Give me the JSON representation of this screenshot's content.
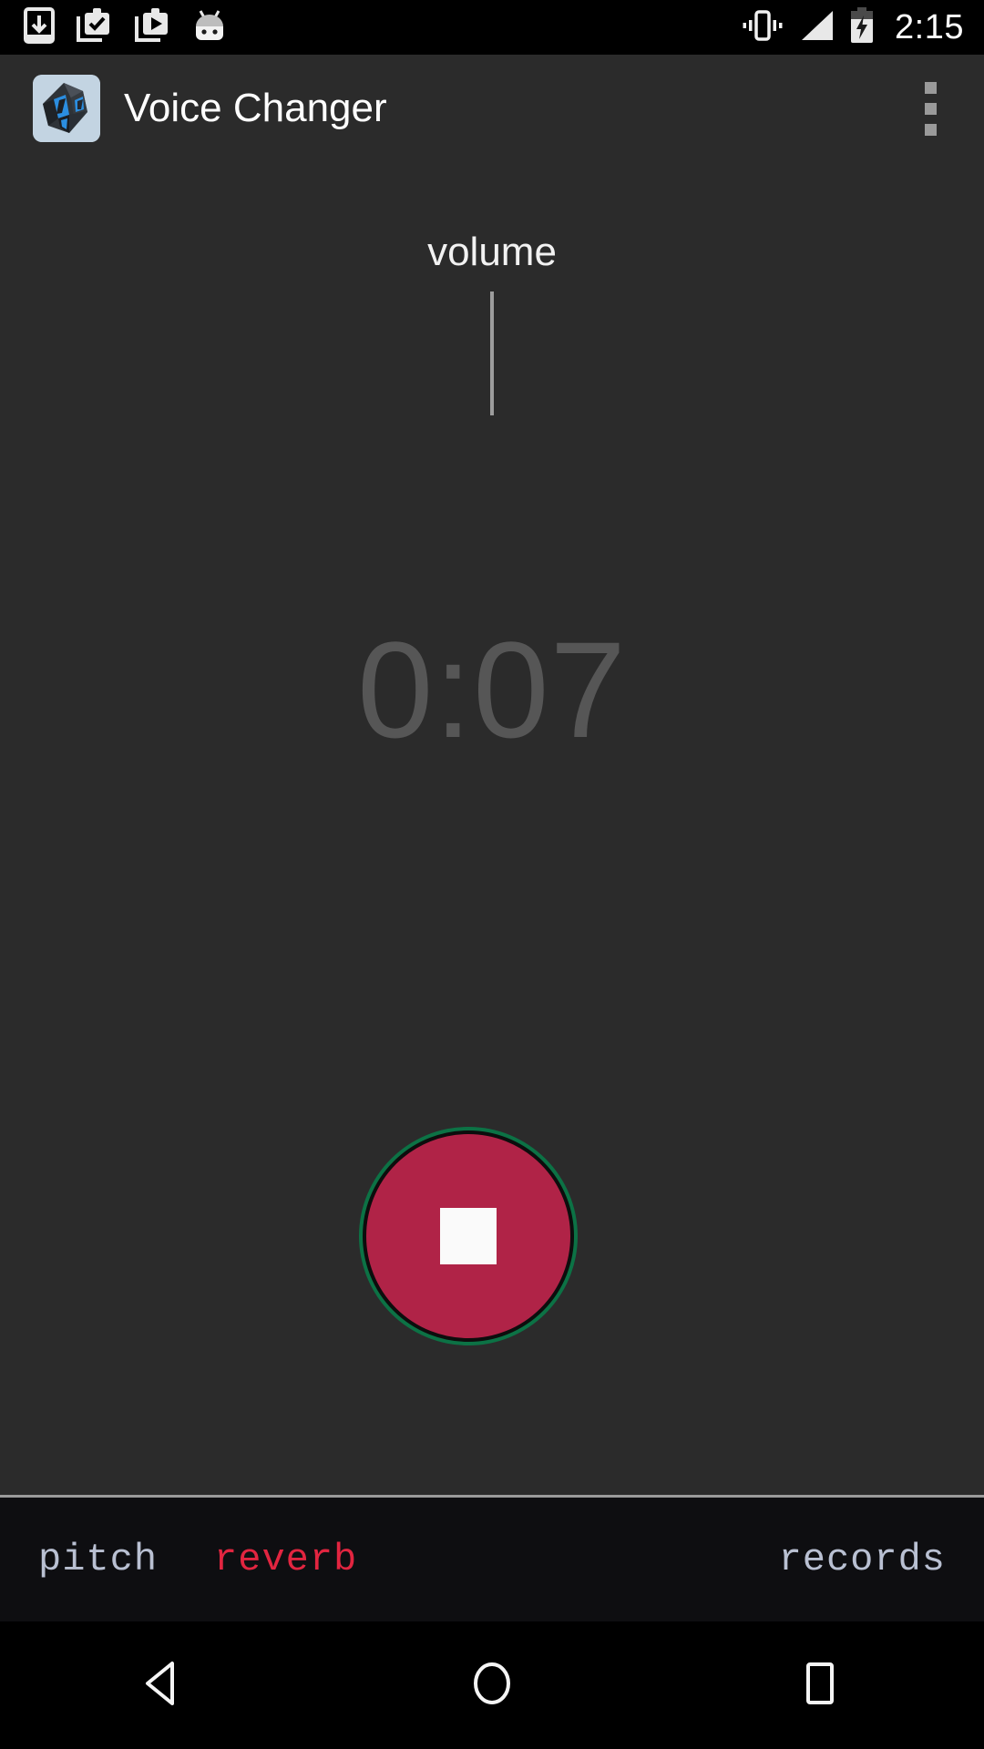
{
  "status_bar": {
    "icons_left": [
      "download-icon",
      "app-install-check-icon",
      "app-install-play-icon",
      "android-head-icon"
    ],
    "icons_right": [
      "vibrate-icon",
      "signal-icon",
      "battery-charging-icon"
    ],
    "time": "2:15"
  },
  "action_bar": {
    "app_icon": "voice-changer-app-icon",
    "title": "Voice Changer",
    "overflow_menu": "overflow-menu-icon"
  },
  "main": {
    "volume_label": "volume",
    "volume_meter": "volume-level-indicator",
    "timer": "0:07",
    "record_button": {
      "name": "stop-recording-button",
      "icon": "stop-square-icon",
      "fill_color": "#b02347",
      "ring_color": "#0c7245",
      "icon_color": "#fafafa"
    }
  },
  "tabs": [
    {
      "label": "pitch",
      "color": "#b9c0d2",
      "active": false
    },
    {
      "label": "reverb",
      "color": "#e22540",
      "active": true
    },
    {
      "label": "records",
      "color": "#b9c0d2",
      "active": false
    }
  ],
  "nav_bar": {
    "back": "back-triangle-icon",
    "home": "home-circle-icon",
    "recents": "recents-square-icon"
  },
  "colors": {
    "background": "#2b2b2b",
    "tab_bar_background": "#0e0e11",
    "status_bar_background": "#000000",
    "timer_text": "#565656",
    "divider": "#9b9b9b"
  }
}
